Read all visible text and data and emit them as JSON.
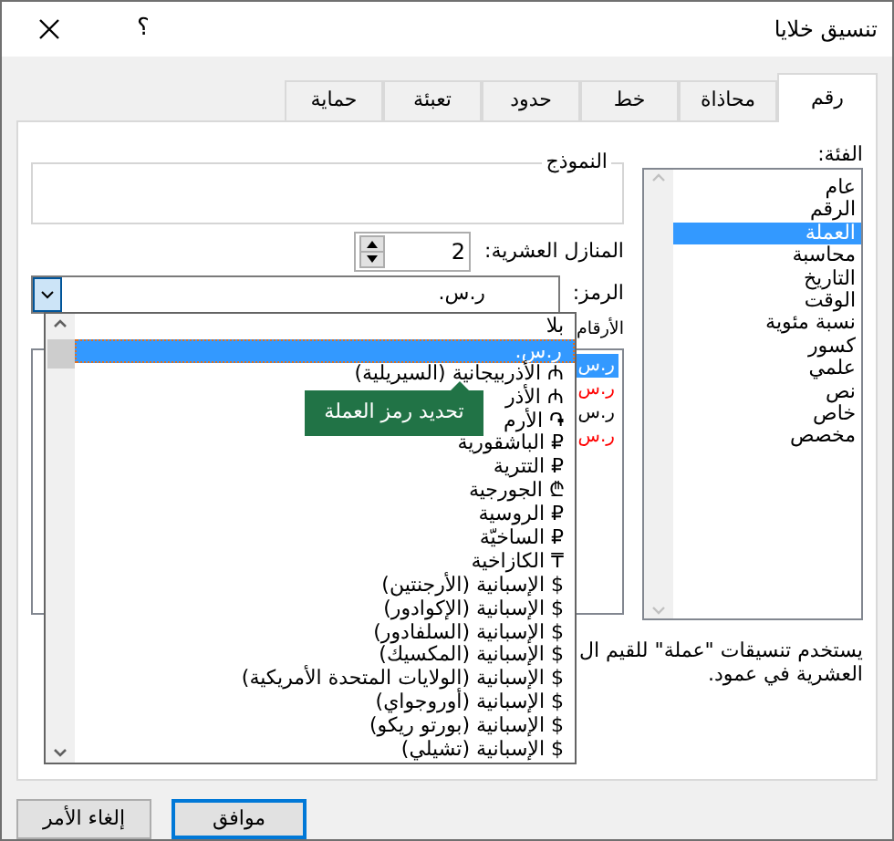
{
  "window": {
    "title": "تنسيق خلايا",
    "help": "؟"
  },
  "tabs": [
    {
      "label": "رقم",
      "selected": true
    },
    {
      "label": "محاذاة",
      "selected": false
    },
    {
      "label": "خط",
      "selected": false
    },
    {
      "label": "حدود",
      "selected": false
    },
    {
      "label": "تعبئة",
      "selected": false
    },
    {
      "label": "حماية",
      "selected": false
    }
  ],
  "category": {
    "label": "الفئة:",
    "items": [
      {
        "text": "عام",
        "selected": false
      },
      {
        "text": "الرقم",
        "selected": false
      },
      {
        "text": "العملة",
        "selected": true
      },
      {
        "text": "محاسبة",
        "selected": false
      },
      {
        "text": "التاريخ",
        "selected": false
      },
      {
        "text": "الوقت",
        "selected": false
      },
      {
        "text": "نسبة مئوية",
        "selected": false
      },
      {
        "text": "كسور",
        "selected": false
      },
      {
        "text": "علمي",
        "selected": false
      },
      {
        "text": "نص",
        "selected": false
      },
      {
        "text": "خاص",
        "selected": false
      },
      {
        "text": "مخصص",
        "selected": false
      }
    ]
  },
  "sample": {
    "label": "النموذج"
  },
  "decimal_places": {
    "label": "المنازل العشرية:",
    "value": "2"
  },
  "symbol": {
    "label": "الرمز:",
    "value": "ر.س."
  },
  "negative_numbers": {
    "label": "الأرقام",
    "items": [
      {
        "text": "ر.س",
        "selected": true
      },
      {
        "text": "ر.س",
        "color": "#ff0000",
        "selected": false
      },
      {
        "text": "ر.س",
        "color": "#000000",
        "selected": false
      },
      {
        "text": "ر.س",
        "color": "#ff0000",
        "selected": false
      }
    ]
  },
  "description": "يستخدم تنسيقات \"عملة\" للقيم ال\nالعشرية في عمود.",
  "symbol_dropdown": {
    "items": [
      {
        "text": "بلا",
        "selected": false
      },
      {
        "text": "ر.س.",
        "selected": true
      },
      {
        "text": "₼ الأذربيجانية (السيريلية)",
        "selected": false
      },
      {
        "text": "₼ الأذر",
        "selected": false
      },
      {
        "text": "֏ الأرم",
        "selected": false
      },
      {
        "text": "₽ الباشقورية",
        "selected": false
      },
      {
        "text": "₽ التترية",
        "selected": false
      },
      {
        "text": "₾ الجورجية",
        "selected": false
      },
      {
        "text": "₽ الروسية",
        "selected": false
      },
      {
        "text": "₽ الساخيّة",
        "selected": false
      },
      {
        "text": "₸ الكازاخية",
        "selected": false
      },
      {
        "text": "$ الإسبانية (الأرجنتين)",
        "selected": false
      },
      {
        "text": "$ الإسبانية (الإكوادور)",
        "selected": false
      },
      {
        "text": "$ الإسبانية (السلفادور)",
        "selected": false
      },
      {
        "text": "$ الإسبانية (المكسيك)",
        "selected": false
      },
      {
        "text": "$ الإسبانية (الولايات المتحدة الأمريكية)",
        "selected": false
      },
      {
        "text": "$ الإسبانية (أوروجواي)",
        "selected": false
      },
      {
        "text": "$ الإسبانية (بورتو ريكو)",
        "selected": false
      },
      {
        "text": "$ الإسبانية (تشيلي)",
        "selected": false
      }
    ]
  },
  "tooltip": "تحديد رمز العملة",
  "buttons": [
    {
      "label": "موافق",
      "default": true
    },
    {
      "label": "إلغاء الأمر",
      "default": false
    }
  ]
}
